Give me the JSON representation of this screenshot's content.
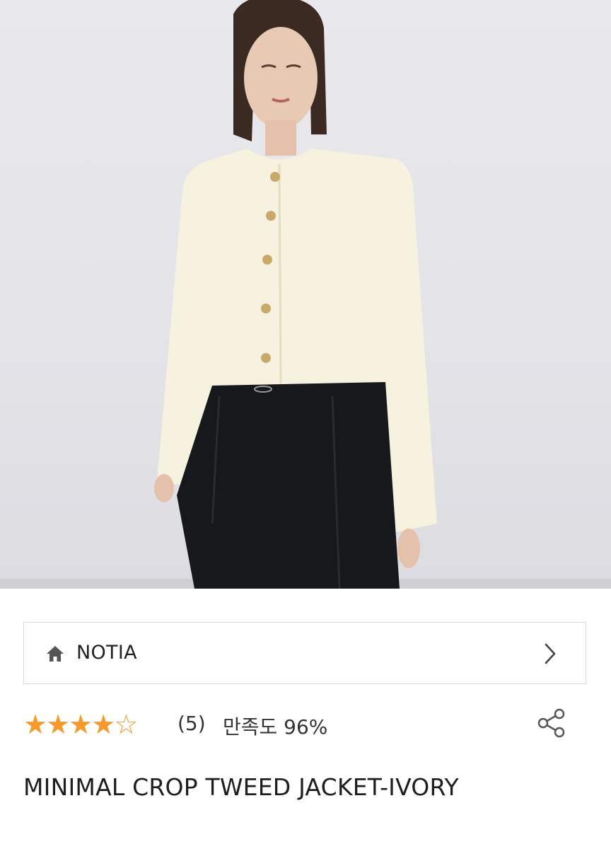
{
  "product": {
    "image_alt": "Model wearing ivory cropped tweed jacket with black trousers",
    "brand": {
      "name": "NOTIA",
      "home_icon": "home-icon",
      "arrow_icon": "chevron-right-icon"
    },
    "rating": {
      "value": 4.5,
      "max": 5,
      "review_count": "(5)",
      "satisfaction": "만족도 96%"
    },
    "share_icon": "share-icon",
    "title": "MINIMAL CROP TWEED JACKET-IVORY"
  },
  "colors": {
    "star": "#f59a2c",
    "border": "#d9d9d9",
    "jacket": "#f6f2df",
    "trousers": "#17181c"
  }
}
